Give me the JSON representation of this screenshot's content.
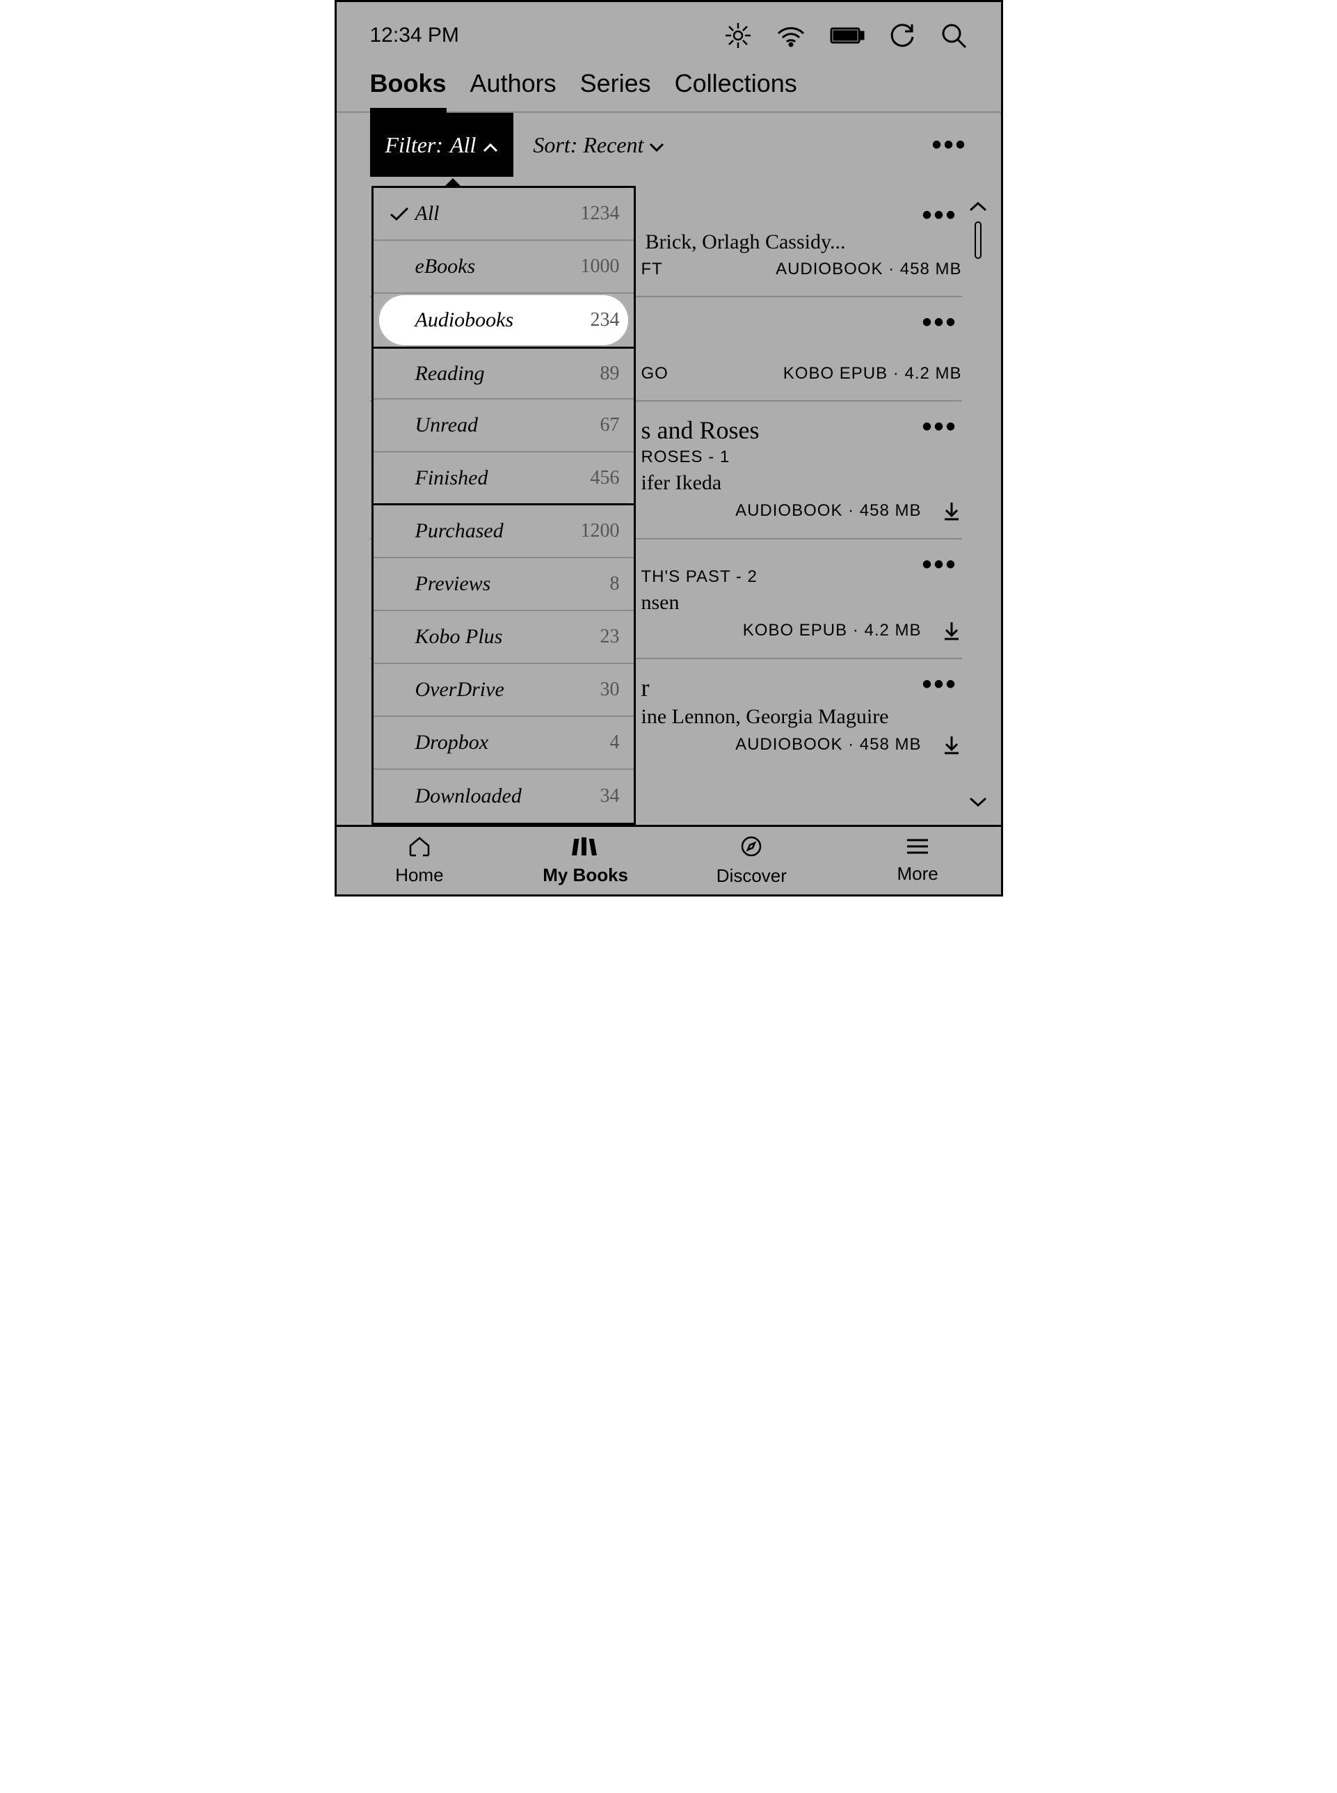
{
  "status": {
    "time": "12:34 PM"
  },
  "tabs": [
    "Books",
    "Authors",
    "Series",
    "Collections"
  ],
  "active_tab": 0,
  "filter": {
    "prefix": "Filter:",
    "value": "All"
  },
  "sort": {
    "prefix": "Sort:",
    "value": "Recent"
  },
  "dropdown": {
    "items": [
      {
        "label": "All",
        "count": "1234",
        "checked": true,
        "sep": false
      },
      {
        "label": "eBooks",
        "count": "1000",
        "checked": false,
        "sep": false
      },
      {
        "label": "Audiobooks",
        "count": "234",
        "checked": false,
        "sep": true,
        "highlight": true
      },
      {
        "label": "Reading",
        "count": "89",
        "checked": false,
        "sep": false
      },
      {
        "label": "Unread",
        "count": "67",
        "checked": false,
        "sep": false
      },
      {
        "label": "Finished",
        "count": "456",
        "checked": false,
        "sep": true
      },
      {
        "label": "Purchased",
        "count": "1200",
        "checked": false,
        "sep": false
      },
      {
        "label": "Previews",
        "count": "8",
        "checked": false,
        "sep": false
      },
      {
        "label": "Kobo Plus",
        "count": "23",
        "checked": false,
        "sep": false
      },
      {
        "label": "OverDrive",
        "count": "30",
        "checked": false,
        "sep": false
      },
      {
        "label": "Dropbox",
        "count": "4",
        "checked": false,
        "sep": false
      },
      {
        "label": "Downloaded",
        "count": "34",
        "checked": false,
        "sep": false
      }
    ]
  },
  "books": [
    {
      "title_fragment": "",
      "series_fragment": "",
      "author_fragment": "Brick, Orlagh Cassidy...",
      "left_meta": "FT",
      "right_meta": "AUDIOBOOK · 458 MB",
      "download": false
    },
    {
      "title_fragment": "",
      "series_fragment": "",
      "author_fragment": "",
      "left_meta": "GO",
      "right_meta": "KOBO EPUB · 4.2 MB",
      "download": false
    },
    {
      "title_fragment": "s and Roses",
      "series_fragment": "ROSES - 1",
      "author_fragment": "ifer Ikeda",
      "left_meta": "",
      "right_meta": "AUDIOBOOK · 458 MB",
      "download": true
    },
    {
      "title_fragment": "",
      "series_fragment": "TH'S PAST - 2",
      "author_fragment": "nsen",
      "left_meta": "",
      "right_meta": "KOBO EPUB · 4.2 MB",
      "download": true
    },
    {
      "title_fragment": "r",
      "series_fragment": "",
      "author_fragment": "ine Lennon, Georgia Maguire",
      "left_meta": "",
      "right_meta": "AUDIOBOOK · 458 MB",
      "download": true
    }
  ],
  "nav": [
    "Home",
    "My Books",
    "Discover",
    "More"
  ],
  "active_nav": 1
}
